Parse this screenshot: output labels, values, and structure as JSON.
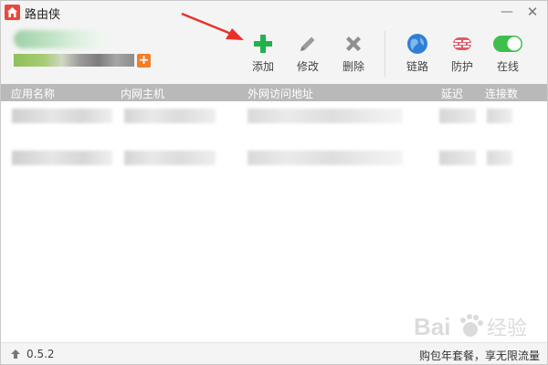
{
  "window": {
    "title": "路由侠",
    "minimize_glyph": "—",
    "close_glyph": "✕"
  },
  "toolbar": {
    "add_label": "添加",
    "edit_label": "修改",
    "delete_label": "删除",
    "link_label": "链路",
    "guard_label": "防护",
    "online_label": "在线"
  },
  "table": {
    "columns": [
      "应用名称",
      "内网主机",
      "外网访问地址",
      "延迟",
      "连接数"
    ]
  },
  "statusbar": {
    "version": "0.5.2",
    "promo": "购包年套餐，享无限流量"
  },
  "watermark": {
    "text": "Bai",
    "suffix": "经验"
  },
  "colors": {
    "accent_green": "#22b24c",
    "brand_red": "#e8493f",
    "toggle_green": "#3cc04b"
  }
}
